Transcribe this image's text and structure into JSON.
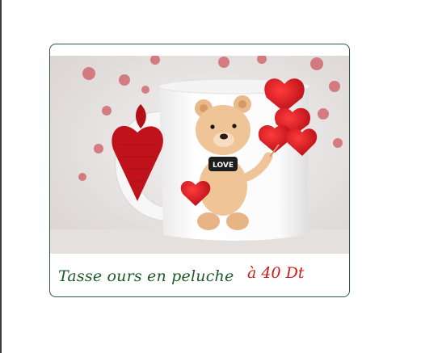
{
  "product": {
    "name": "Tasse ours en peluche",
    "price": "à 40 Dt",
    "image_subject": "white-mug-with-teddy-bear-and-red-hearts",
    "colors": {
      "name_text": "#1f5a2a",
      "price_text": "#d01a1a",
      "card_border": "#2f5a3c",
      "heart_red": "#c8141e"
    },
    "bear_shirt_text": "LOVE"
  }
}
